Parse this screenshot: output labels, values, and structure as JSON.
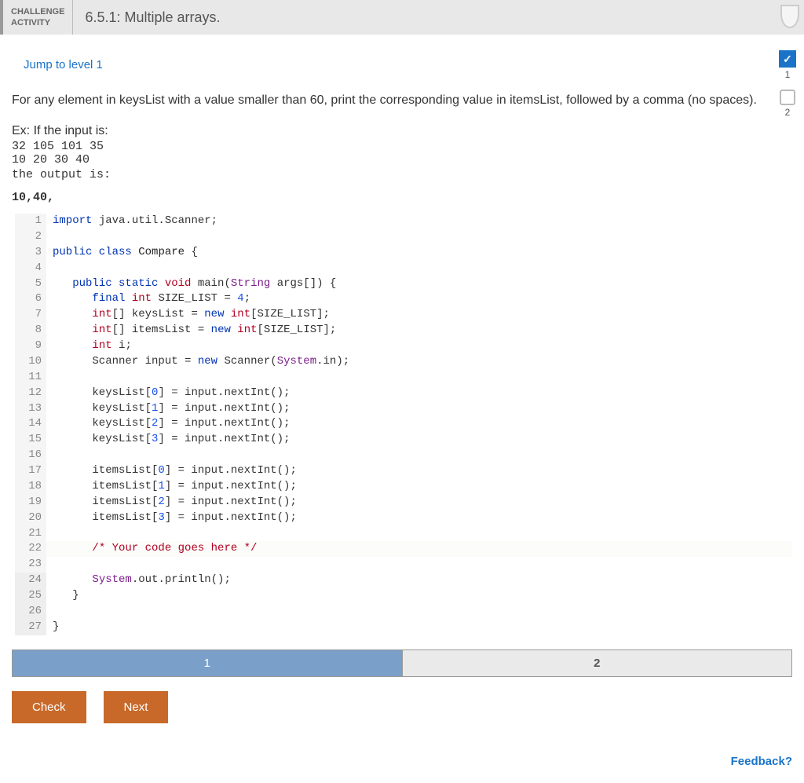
{
  "header": {
    "label_line1": "CHALLENGE",
    "label_line2": "ACTIVITY",
    "title": "6.5.1: Multiple arrays."
  },
  "jump_link": "Jump to level 1",
  "levels": {
    "level1_check": "✓",
    "level1_num": "1",
    "level2_num": "2"
  },
  "instructions": "For any element in keysList with a value smaller than 60, print the corresponding value in itemsList, followed by a comma (no spaces).",
  "example": {
    "prefix": "Ex: If the input is:",
    "input_line1": "32 105 101 35",
    "input_line2": "10 20 30 40",
    "output_prefix": "the output is:",
    "output": "10,40,"
  },
  "code": {
    "lines": [
      {
        "n": "1",
        "html": "<span class='kw-blue'>import</span> java.util.Scanner;"
      },
      {
        "n": "2",
        "html": ""
      },
      {
        "n": "3",
        "html": "<span class='kw-blue'>public class</span> <span class='kw-cls'>Compare</span> {"
      },
      {
        "n": "4",
        "html": ""
      },
      {
        "n": "5",
        "html": "   <span class='kw-blue'>public static</span> <span class='kw-red'>void</span> main(<span class='kw-purple'>String</span> args[]) {"
      },
      {
        "n": "6",
        "html": "      <span class='kw-blue'>final</span> <span class='kw-red'>int</span> SIZE_LIST = <span class='kw-num'>4</span>;"
      },
      {
        "n": "7",
        "html": "      <span class='kw-red'>int</span>[] keysList = <span class='kw-blue'>new</span> <span class='kw-red'>int</span>[SIZE_LIST];"
      },
      {
        "n": "8",
        "html": "      <span class='kw-red'>int</span>[] itemsList = <span class='kw-blue'>new</span> <span class='kw-red'>int</span>[SIZE_LIST];"
      },
      {
        "n": "9",
        "html": "      <span class='kw-red'>int</span> i;"
      },
      {
        "n": "10",
        "html": "      Scanner input = <span class='kw-blue'>new</span> Scanner(<span class='kw-purple'>System</span>.in);"
      },
      {
        "n": "11",
        "html": ""
      },
      {
        "n": "12",
        "html": "      keysList[<span class='kw-num'>0</span>] = input.nextInt();"
      },
      {
        "n": "13",
        "html": "      keysList[<span class='kw-num'>1</span>] = input.nextInt();"
      },
      {
        "n": "14",
        "html": "      keysList[<span class='kw-num'>2</span>] = input.nextInt();"
      },
      {
        "n": "15",
        "html": "      keysList[<span class='kw-num'>3</span>] = input.nextInt();"
      },
      {
        "n": "16",
        "html": ""
      },
      {
        "n": "17",
        "html": "      itemsList[<span class='kw-num'>0</span>] = input.nextInt();"
      },
      {
        "n": "18",
        "html": "      itemsList[<span class='kw-num'>1</span>] = input.nextInt();"
      },
      {
        "n": "19",
        "html": "      itemsList[<span class='kw-num'>2</span>] = input.nextInt();"
      },
      {
        "n": "20",
        "html": "      itemsList[<span class='kw-num'>3</span>] = input.nextInt();"
      },
      {
        "n": "21",
        "html": ""
      },
      {
        "n": "22",
        "html": "      <span class='cmt'>/* Your code goes here */</span>",
        "hl": true
      },
      {
        "n": "23",
        "html": ""
      },
      {
        "n": "24",
        "html": "      <span class='kw-purple'>System</span>.out.println();",
        "grey": true
      },
      {
        "n": "25",
        "html": "   }",
        "grey": true
      },
      {
        "n": "26",
        "html": "",
        "grey": true
      },
      {
        "n": "27",
        "html": "}",
        "grey": true
      }
    ]
  },
  "progress": {
    "seg1": "1",
    "seg2": "2"
  },
  "buttons": {
    "check": "Check",
    "next": "Next"
  },
  "feedback": "Feedback?"
}
